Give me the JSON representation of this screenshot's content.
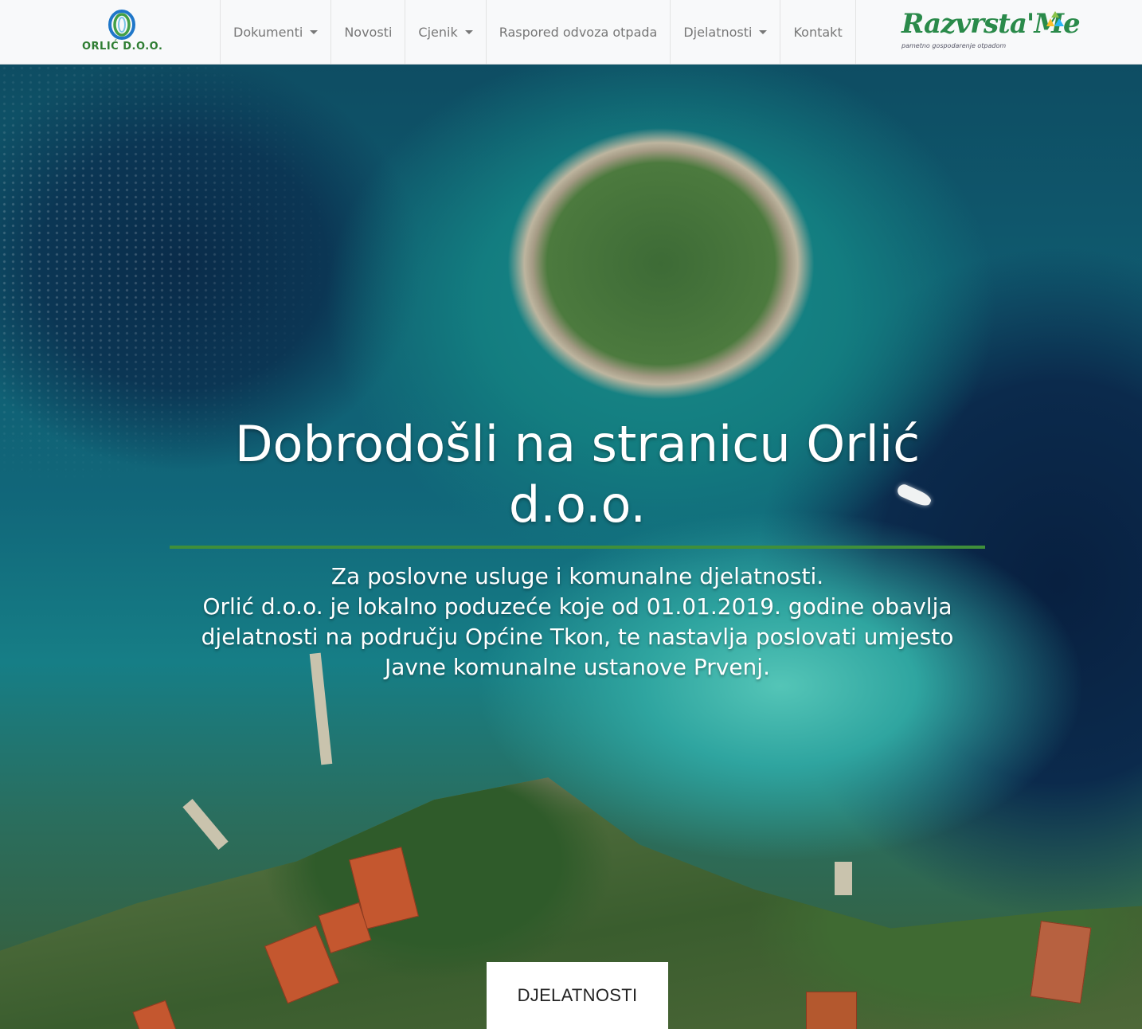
{
  "brand": {
    "name": "ORLIĆ D.O.O.",
    "colors": {
      "ring_blue": "#1f77c9",
      "ring_green": "#43a047",
      "text_green": "#2e7d32"
    }
  },
  "nav": {
    "items": [
      {
        "label": "Dokumenti",
        "dropdown": true
      },
      {
        "label": "Novosti",
        "dropdown": false
      },
      {
        "label": "Cjenik",
        "dropdown": true
      },
      {
        "label": "Raspored odvoza otpada",
        "dropdown": false
      },
      {
        "label": "Djelatnosti",
        "dropdown": true
      },
      {
        "label": "Kontakt",
        "dropdown": false
      }
    ]
  },
  "partner": {
    "name": "Razvrsta'Me",
    "tagline": "pametno gospodarenje otpadom"
  },
  "hero": {
    "title": "Dobrodošli na stranicu Orlić d.o.o.",
    "subtitle_line1": "Za poslovne usluge i komunalne djelatnosti.",
    "subtitle_line2": "Orlić d.o.o. je lokalno poduzeće koje od 01.01.2019. godine obavlja djelatnosti na području Općine Tkon, te nastavlja poslovati umjesto Javne komunalne ustanove Prvenj.",
    "button_label": "DJELATNOSTI",
    "accent_color": "#3f8f3a"
  }
}
